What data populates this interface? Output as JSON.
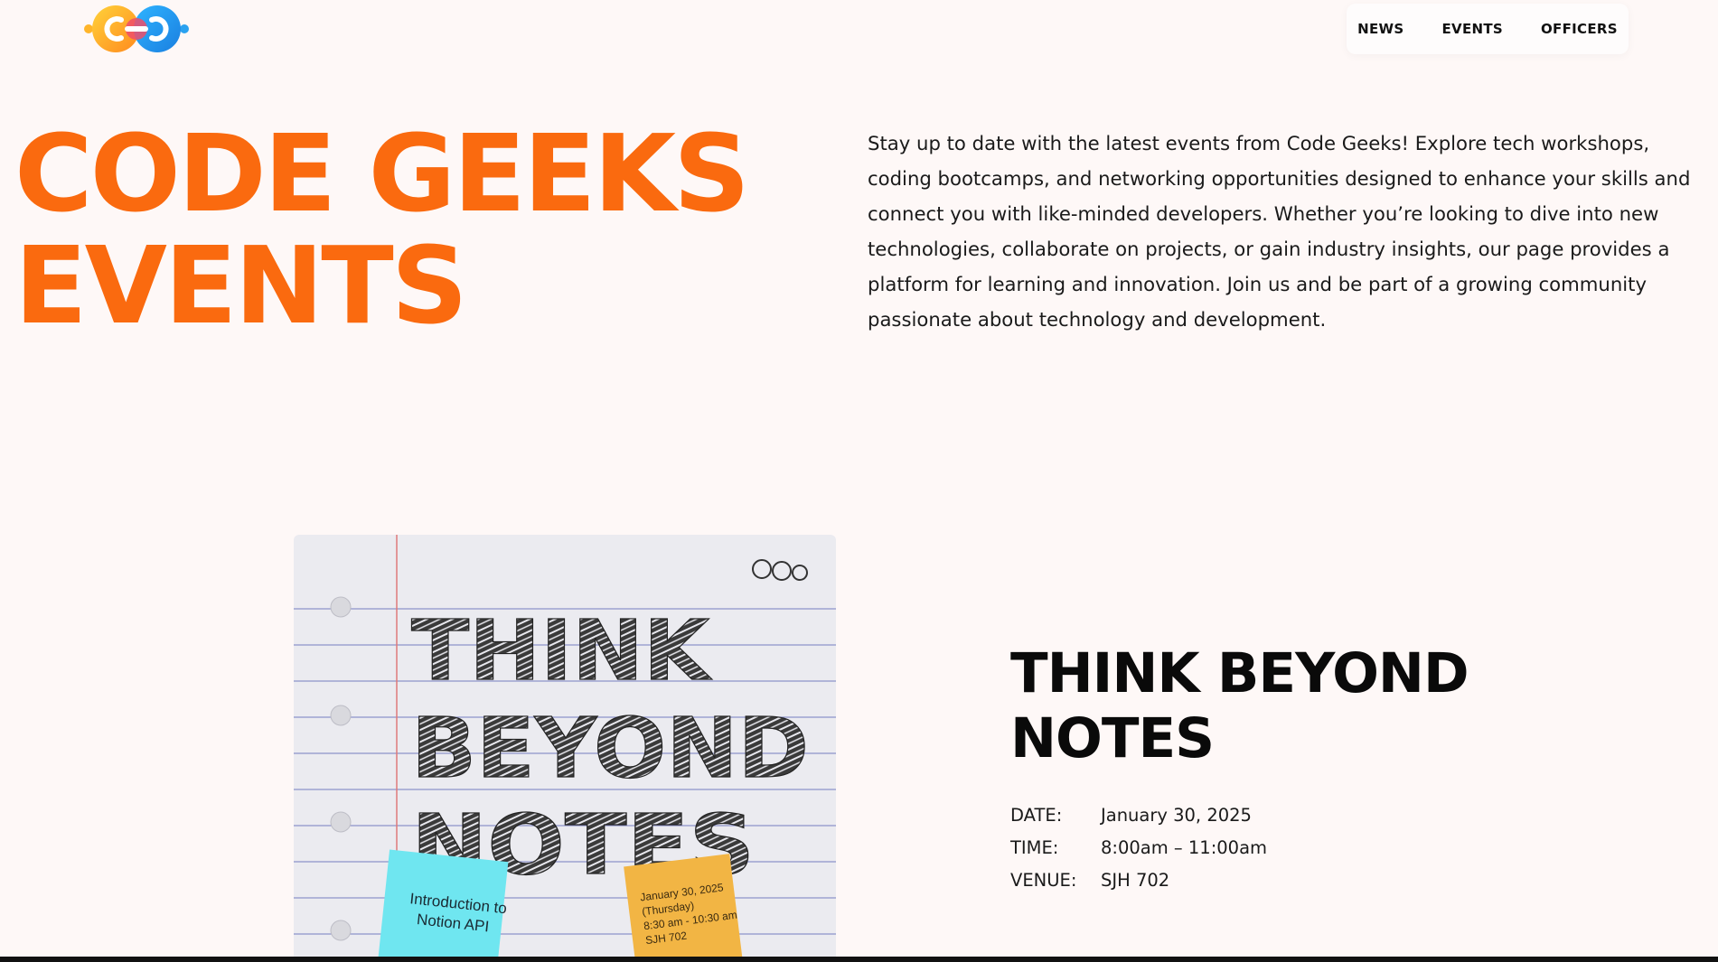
{
  "header": {
    "logo_name": "code-geeks-logo",
    "nav": [
      {
        "label": "NEWS"
      },
      {
        "label": "EVENTS"
      },
      {
        "label": "OFFICERS"
      }
    ]
  },
  "hero": {
    "title_line1": "CODE GEEKS",
    "title_line2": "EVENTS",
    "description": "Stay up to date with the latest events from Code Geeks! Explore tech workshops, coding bootcamps, and networking opportunities designed to enhance your skills and connect you with like-minded developers. Whether you’re looking to dive into new technologies, collaborate on projects, or gain industry insights, our page provides a platform for learning and innovation. Join us and be part of a growing community passionate about technology and development."
  },
  "event": {
    "poster": {
      "headline_lines": [
        "THINK",
        "BEYOND",
        "NOTES"
      ],
      "sticky_left_lines": [
        "Introduction to",
        "Notion API"
      ],
      "sticky_right_lines": [
        "January 30, 2025",
        "(Thursday)",
        "8:30 am - 10:30 am",
        "SJH 702"
      ]
    },
    "title_line1": "THINK BEYOND",
    "title_line2": "NOTES",
    "date_label": "DATE:",
    "date_value": "January 30, 2025",
    "time_label": "TIME:",
    "time_value": "8:00am – 11:00am",
    "venue_label": "VENUE:",
    "venue_value": "SJH 702"
  },
  "colors": {
    "accent": "#fa6a0f",
    "background": "#fef8f7",
    "sticky_cyan": "#6fe6f0",
    "sticky_orange": "#f2b544"
  }
}
